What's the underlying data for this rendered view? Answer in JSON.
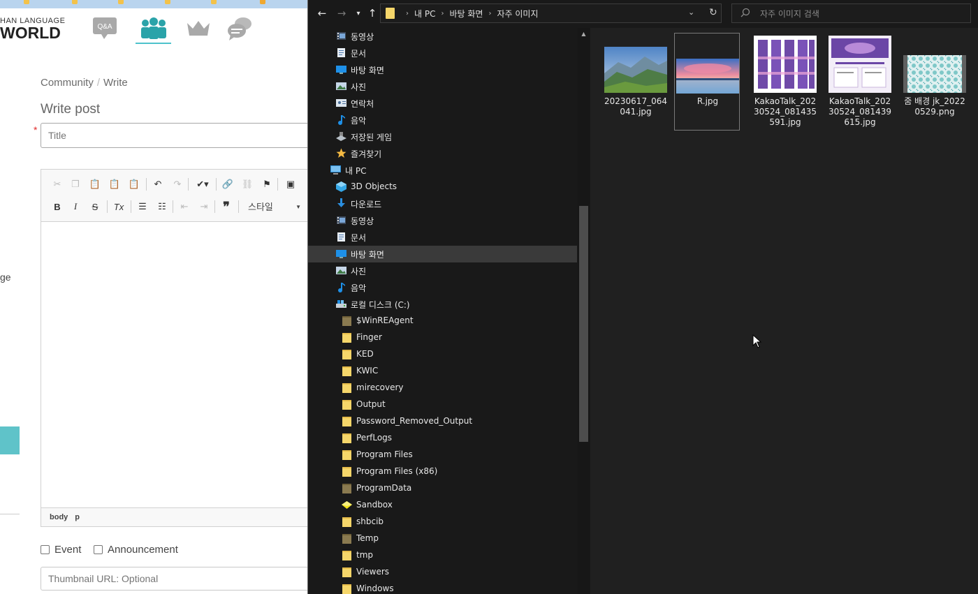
{
  "web": {
    "logo_top": "HAN LANGUAGE",
    "logo_bottom": "WORLD",
    "nav": {
      "qa_label": "Q&A"
    },
    "breadcrumb": {
      "community": "Community",
      "separator": "/",
      "write": "Write"
    },
    "page_title": "Write post",
    "title_required_mark": "*",
    "title_placeholder": "Title",
    "editor": {
      "style_combo_label": "스타일",
      "path": [
        "body",
        "p"
      ]
    },
    "side_text": "ge",
    "checkboxes": {
      "event_label": "Event",
      "announcement_label": "Announcement"
    },
    "thumbnail_placeholder": "Thumbnail URL: Optional"
  },
  "explorer": {
    "breadcrumbs": [
      "내 PC",
      "바탕 화면",
      "자주 이미지"
    ],
    "search_placeholder": "자주 이미지 검색",
    "nav_items": [
      {
        "label": "동영상",
        "icon": "video-icon",
        "indent": 1
      },
      {
        "label": "문서",
        "icon": "document-icon",
        "indent": 1
      },
      {
        "label": "바탕 화면",
        "icon": "desktop-icon",
        "indent": 1
      },
      {
        "label": "사진",
        "icon": "picture-icon",
        "indent": 1
      },
      {
        "label": "연락처",
        "icon": "contacts-icon",
        "indent": 1
      },
      {
        "label": "음악",
        "icon": "music-icon",
        "indent": 1
      },
      {
        "label": "저장된 게임",
        "icon": "saved-games-icon",
        "indent": 1
      },
      {
        "label": "즐겨찾기",
        "icon": "favorites-icon",
        "indent": 1
      },
      {
        "label": "내 PC",
        "icon": "this-pc-icon",
        "indent": 0
      },
      {
        "label": "3D Objects",
        "icon": "3d-objects-icon",
        "indent": 1
      },
      {
        "label": "다운로드",
        "icon": "download-icon",
        "indent": 1
      },
      {
        "label": "동영상",
        "icon": "video-icon",
        "indent": 1
      },
      {
        "label": "문서",
        "icon": "document-icon",
        "indent": 1
      },
      {
        "label": "바탕 화면",
        "icon": "desktop-icon",
        "indent": 1,
        "selected": true
      },
      {
        "label": "사진",
        "icon": "picture-icon",
        "indent": 1
      },
      {
        "label": "음악",
        "icon": "music-icon",
        "indent": 1
      },
      {
        "label": "로컬 디스크 (C:)",
        "icon": "local-disk-icon",
        "indent": 1
      },
      {
        "label": "$WinREAgent",
        "icon": "folder-icon",
        "indent": 2,
        "dim": true
      },
      {
        "label": "Finger",
        "icon": "folder-icon",
        "indent": 2
      },
      {
        "label": "KED",
        "icon": "folder-icon",
        "indent": 2
      },
      {
        "label": "KWIC",
        "icon": "folder-icon",
        "indent": 2
      },
      {
        "label": "mirecovery",
        "icon": "folder-icon",
        "indent": 2
      },
      {
        "label": "Output",
        "icon": "folder-icon",
        "indent": 2
      },
      {
        "label": "Password_Removed_Output",
        "icon": "folder-icon",
        "indent": 2
      },
      {
        "label": "PerfLogs",
        "icon": "folder-icon",
        "indent": 2
      },
      {
        "label": "Program Files",
        "icon": "folder-icon",
        "indent": 2
      },
      {
        "label": "Program Files (x86)",
        "icon": "folder-icon",
        "indent": 2
      },
      {
        "label": "ProgramData",
        "icon": "folder-icon",
        "indent": 2,
        "dim": true
      },
      {
        "label": "Sandbox",
        "icon": "sandbox-icon",
        "indent": 2
      },
      {
        "label": "shbcib",
        "icon": "folder-icon",
        "indent": 2
      },
      {
        "label": "Temp",
        "icon": "folder-icon",
        "indent": 2,
        "dim": true
      },
      {
        "label": "tmp",
        "icon": "folder-icon",
        "indent": 2
      },
      {
        "label": "Viewers",
        "icon": "folder-icon",
        "indent": 2
      },
      {
        "label": "Windows",
        "icon": "folder-icon",
        "indent": 2
      }
    ],
    "files": [
      {
        "name": "20230617_064041.jpg",
        "thumb": "mountain"
      },
      {
        "name": "R.jpg",
        "thumb": "sunset",
        "selected": true
      },
      {
        "name": "KakaoTalk_20230524_081435591.jpg",
        "thumb": "kakao-cards"
      },
      {
        "name": "KakaoTalk_20230524_081439615.jpg",
        "thumb": "kakao-page"
      },
      {
        "name": "줌 배경 jk_20220529.png",
        "thumb": "pattern"
      }
    ]
  },
  "colors": {
    "accent_teal": "#4ec3cc",
    "folder_yellow": "#f5d66a",
    "explorer_bg": "#191919",
    "selected_row": "#3a3a3a"
  }
}
